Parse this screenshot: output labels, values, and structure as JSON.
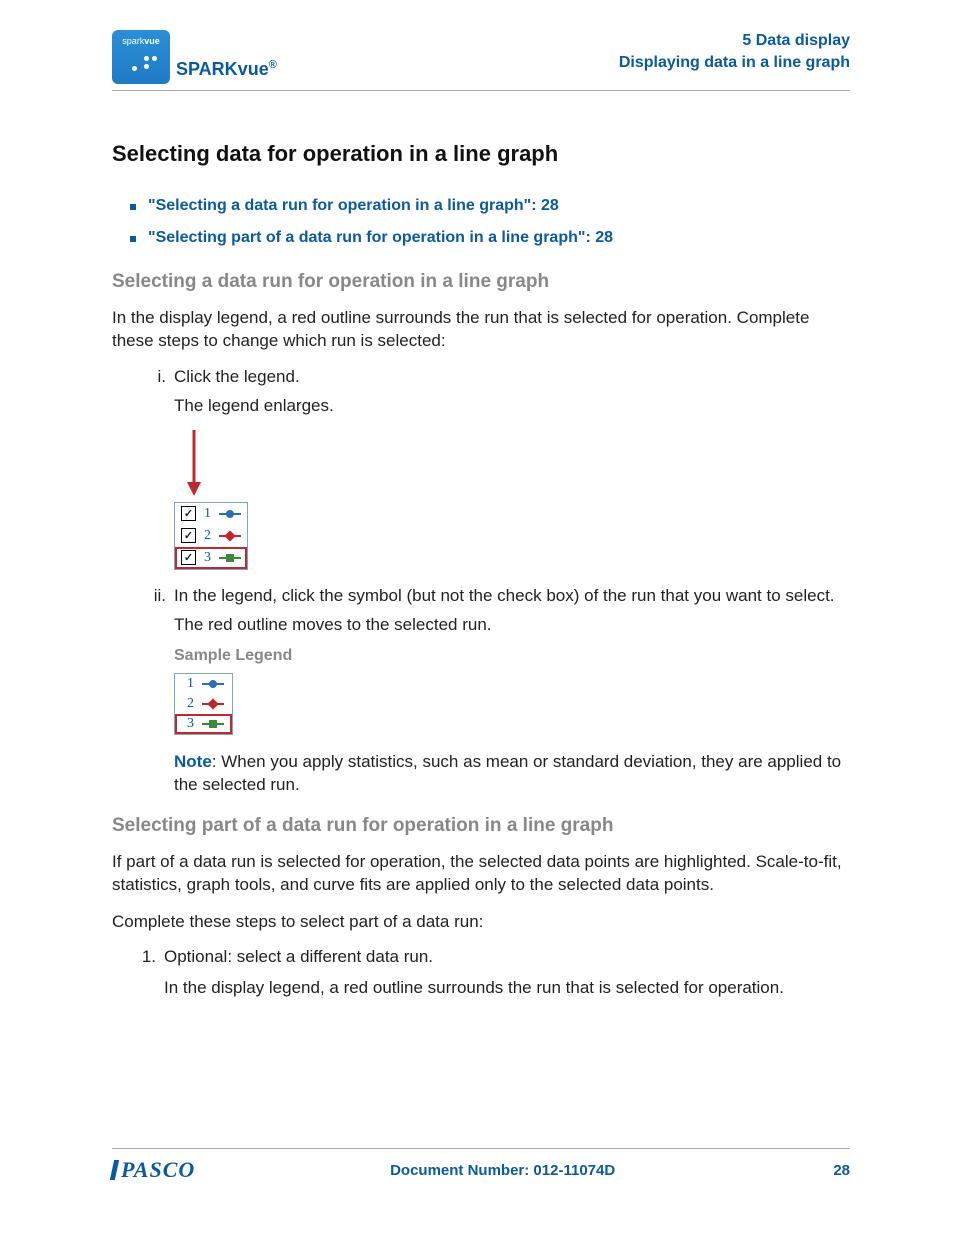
{
  "header": {
    "product_logo_text_light": "spark",
    "product_logo_text_bold": "vue",
    "product_name_prefix": "SPARK",
    "product_name_suffix": "vue",
    "product_name_reg": "®",
    "section_number": "5   Data display",
    "section_sub": "Displaying data in a line graph"
  },
  "title": "Selecting data for operation in a line graph",
  "toc": [
    "\"Selecting a data run for operation in a line graph\":  28",
    "\"Selecting part of a data run for operation in a line graph\":  28"
  ],
  "sub1": {
    "heading": "Selecting a data run for operation in a line graph",
    "intro": "In the display legend, a red outline surrounds the run that is selected for operation. Complete these steps to change which run is selected:",
    "steps": {
      "i_marker": "i.",
      "i_text": "Click the legend.",
      "i_result": "The legend enlarges.",
      "ii_marker": "ii.",
      "ii_text": "In the legend, click the symbol (but not the check box) of the run that you want to select.",
      "ii_result": "The red outline moves to the selected run.",
      "sample_caption": "Sample Legend",
      "note_label": "Note",
      "note_text": ": When you apply statistics, such as mean or standard deviation, they are applied to the selected run."
    },
    "legend1": {
      "rows": [
        {
          "num": "1",
          "check": "✓"
        },
        {
          "num": "2",
          "check": "✓"
        },
        {
          "num": "3",
          "check": "✓"
        }
      ]
    },
    "legend2": {
      "rows": [
        {
          "num": "1"
        },
        {
          "num": "2"
        },
        {
          "num": "3"
        }
      ]
    }
  },
  "sub2": {
    "heading": "Selecting part of a data run for operation in a line graph",
    "p1": "If part of a data run is selected for operation, the selected data points are highlighted. Scale-to-fit, statistics, graph tools, and curve fits are applied only to the selected data points.",
    "p2": "Complete these steps to select part of a data run:",
    "steps": {
      "n1_marker": "1.",
      "n1_text": "Optional: select a different data run.",
      "n1_result": "In the display legend, a red outline surrounds the run that is selected for operation."
    }
  },
  "footer": {
    "brand": "PASCO",
    "docnum": "Document Number: 012-11074D",
    "page": "28"
  }
}
